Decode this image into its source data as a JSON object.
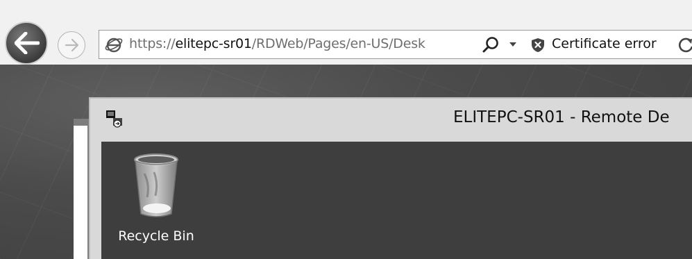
{
  "browser": {
    "address": {
      "scheme": "https://",
      "host": "elitepc-sr01",
      "path": "/RDWeb/Pages/en-US/Desk"
    },
    "certificate_error": "Certificate error"
  },
  "remote_desktop": {
    "title": "ELITEPC-SR01 - Remote De"
  },
  "desktop": {
    "icons": [
      {
        "label": "Recycle Bin",
        "icon": "recycle-bin-icon"
      }
    ]
  }
}
